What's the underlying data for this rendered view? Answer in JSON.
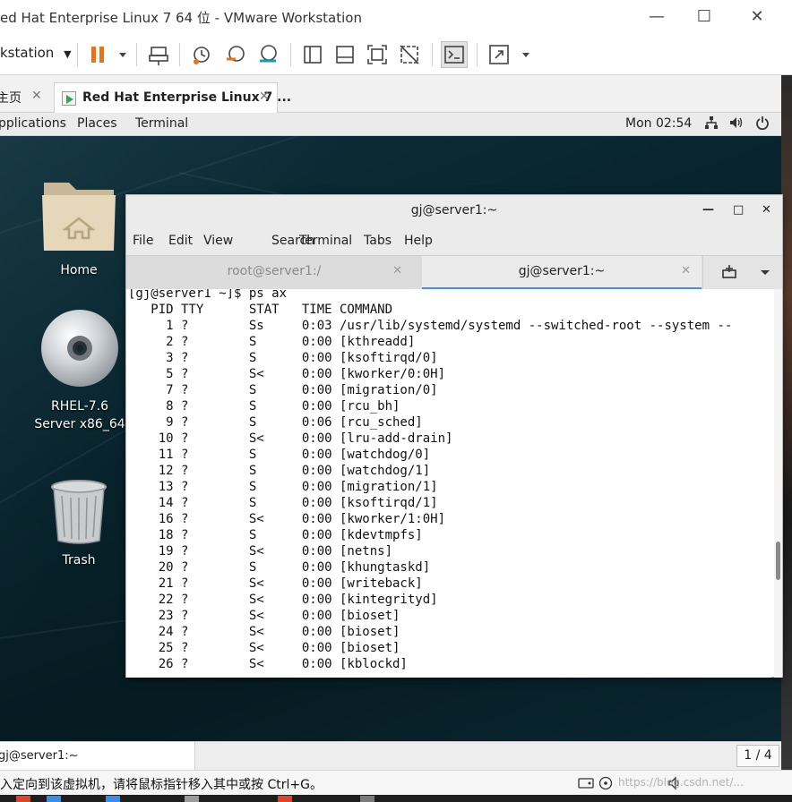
{
  "vmware": {
    "window_title": "ed Hat Enterprise Linux 7 64 位 - VMware Workstation",
    "workstation_menu": "kstation",
    "tabs": [
      {
        "label": "主页"
      },
      {
        "label": "Red Hat Enterprise Linux 7 ..."
      }
    ],
    "bottom_tab": "gj@server1:~",
    "pager": "1 / 4",
    "status_message": "入定向到该虚拟机，请将鼠标指针移入其中或按 Ctrl+G。",
    "watermark": "https://blog.csdn.net/..."
  },
  "gnome": {
    "applications": "pplications",
    "places": "Places",
    "terminal": "Terminal",
    "clock": "Mon 02:54"
  },
  "desktop": {
    "icons": [
      {
        "label": "Home"
      },
      {
        "label": "RHEL-7.6 Server x86_64"
      },
      {
        "label": "Trash"
      }
    ]
  },
  "terminal": {
    "title": "gj@server1:~",
    "menu": [
      "File",
      "Edit",
      "View",
      "Search",
      "Terminal",
      "Tabs",
      "Help"
    ],
    "tabs": [
      {
        "label": "root@server1:/"
      },
      {
        "label": "gj@server1:~"
      }
    ],
    "lines": [
      "[gj@server1 ~]$ ps ax",
      "   PID TTY      STAT   TIME COMMAND",
      "     1 ?        Ss     0:03 /usr/lib/systemd/systemd --switched-root --system --",
      "     2 ?        S      0:00 [kthreadd]",
      "     3 ?        S      0:00 [ksoftirqd/0]",
      "     5 ?        S<     0:00 [kworker/0:0H]",
      "     7 ?        S      0:00 [migration/0]",
      "     8 ?        S      0:00 [rcu_bh]",
      "     9 ?        S      0:06 [rcu_sched]",
      "    10 ?        S<     0:00 [lru-add-drain]",
      "    11 ?        S      0:00 [watchdog/0]",
      "    12 ?        S      0:00 [watchdog/1]",
      "    13 ?        S      0:00 [migration/1]",
      "    14 ?        S      0:00 [ksoftirqd/1]",
      "    16 ?        S<     0:00 [kworker/1:0H]",
      "    18 ?        S      0:00 [kdevtmpfs]",
      "    19 ?        S<     0:00 [netns]",
      "    20 ?        S      0:00 [khungtaskd]",
      "    21 ?        S<     0:00 [writeback]",
      "    22 ?        S<     0:00 [kintegrityd]",
      "    23 ?        S<     0:00 [bioset]",
      "    24 ?        S<     0:00 [bioset]",
      "    25 ?        S<     0:00 [bioset]",
      "    26 ?        S<     0:00 [kblockd]"
    ],
    "scroll_position": 0.72,
    "scroll_visible_fraction": 0.1
  },
  "colors": {
    "pause_accent": "#e8731a",
    "active_tab_underline": "#4a90d9",
    "desktop_bg": "#08232c"
  }
}
